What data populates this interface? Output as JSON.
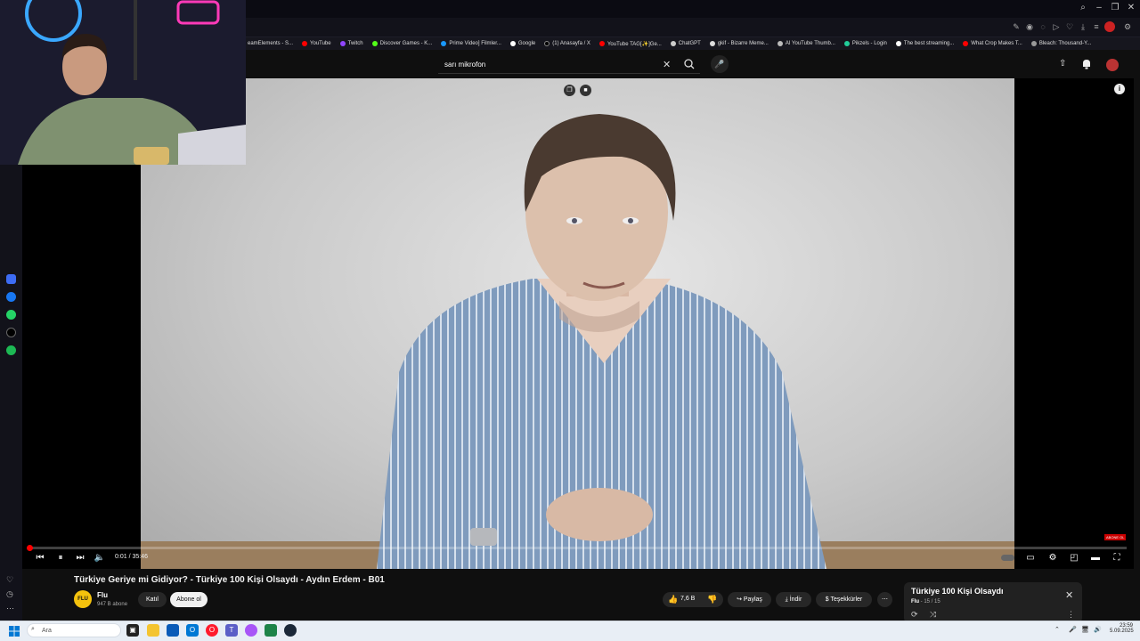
{
  "browser": {
    "bookmarks": [
      "eamElements - S...",
      "YouTube",
      "Twitch",
      "Discover Games - K...",
      "Prime Video] Filmler...",
      "Google",
      "(1) Anasayfa / X",
      "YouTube TAG[✨]Ge...",
      "ChatGPT",
      "gkif - Bizarre Meme...",
      "AI YouTube Thumb...",
      "Pikzels - Login",
      "The best streaming...",
      "What Crop Makes T...",
      "Bleach: Thousand-Y..."
    ]
  },
  "youtube": {
    "search_value": "sarı mikrofon",
    "video_title": "Türkiye Geriye mi Gidiyor? - Türkiye 100 Kişi Olsaydı - Aydın Erdem - B01",
    "channel": {
      "avatar_text": "FLU",
      "name": "Flu",
      "subscribers": "947 B abone"
    },
    "join_label": "Katıl",
    "subscribe_label": "Abone ol",
    "likes": "7,6 B",
    "share_label": "Paylaş",
    "download_label": "İndir",
    "thanks_label": "Teşekkürler",
    "time": "0:01 / 35:46",
    "progress_fraction": 0.0005,
    "badge": "ABONE OL",
    "playlist": {
      "title": "Türkiye 100 Kişi Olsaydı",
      "channel": "Flu",
      "position": "15 / 15"
    }
  },
  "taskbar": {
    "search_placeholder": "Ara",
    "time": "23:59",
    "date": "5.09.2025"
  },
  "colors": {
    "accent": "#ff0000",
    "background": "#0f0f0f",
    "pill": "#272727"
  }
}
